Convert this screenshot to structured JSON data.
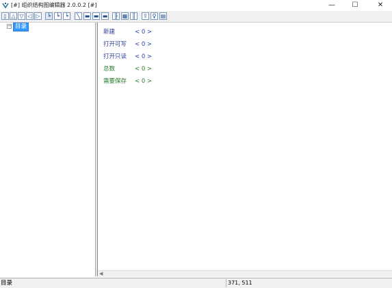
{
  "window": {
    "title": "[#] 组织结构图编辑器 2.0.0.2 [#]",
    "min_glyph": "—",
    "max_glyph": "☐",
    "close_glyph": "✕"
  },
  "toolbar": {
    "icons": [
      "new-doc-icon",
      "shape-up-icon",
      "shape-down-icon",
      "arrow-left-icon",
      "arrow-right-icon",
      "tree-layout-1-icon",
      "tree-layout-2-icon",
      "tree-layout-3-icon",
      "line-tool-icon",
      "box-tool-1-icon",
      "box-tool-2-icon",
      "box-tool-3-icon",
      "align-1-icon",
      "align-2-icon",
      "align-3-icon",
      "export-icon",
      "settings-icon",
      "print-icon"
    ]
  },
  "tree": {
    "root_toggle": "⊟",
    "root_label": "目录"
  },
  "info": {
    "rows": [
      {
        "label": "新建",
        "value": "< 0 >"
      },
      {
        "label": "打开可写",
        "value": "< 0 >"
      },
      {
        "label": "打开只读",
        "value": "< 0 >"
      },
      {
        "label": "总数",
        "value": "< 0 >"
      },
      {
        "label": "需要保存",
        "value": "< 0 >"
      }
    ]
  },
  "statusbar": {
    "left_text": "目录",
    "coords": "371, 511"
  },
  "colors": {
    "label_blue": "#2a3f9c",
    "label_green": "#2a7a2a",
    "selection": "#3399ff"
  }
}
